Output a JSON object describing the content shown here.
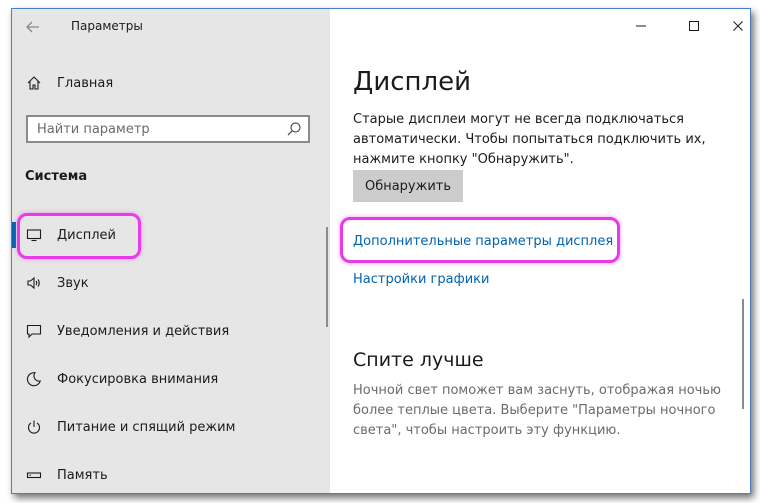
{
  "window": {
    "title": "Параметры",
    "controls": {
      "minimize_icon": "minimize-icon",
      "maximize_icon": "maximize-icon",
      "close_icon": "close-icon"
    }
  },
  "sidebar": {
    "home_label": "Главная",
    "search": {
      "placeholder": "Найти параметр",
      "value": ""
    },
    "section_label": "Система",
    "items": [
      {
        "label": "Дисплей",
        "icon": "monitor-icon",
        "active": true
      },
      {
        "label": "Звук",
        "icon": "speaker-icon"
      },
      {
        "label": "Уведомления и действия",
        "icon": "notification-icon"
      },
      {
        "label": "Фокусировка внимания",
        "icon": "moon-icon"
      },
      {
        "label": "Питание и спящий режим",
        "icon": "power-icon"
      },
      {
        "label": "Память",
        "icon": "storage-icon"
      }
    ]
  },
  "content": {
    "title": "Дисплей",
    "description": "Старые дисплеи могут не всегда подключаться автоматически. Чтобы попытаться подключить их, нажмите кнопку \"Обнаружить\".",
    "detect_button": "Обнаружить",
    "links": {
      "advanced_display": "Дополнительные параметры дисплея",
      "graphics_settings": "Настройки графики"
    },
    "sleep_section": {
      "title": "Спите лучше",
      "description": "Ночной свет поможет вам заснуть, отображая ночью более теплые цвета. Выберите \"Параметры ночного света\", чтобы настроить эту функцию."
    }
  },
  "colors": {
    "accent": "#0066b4",
    "link": "#0063b1",
    "highlight": "#e83ae8",
    "sidebar_bg": "#e6e6e6"
  }
}
